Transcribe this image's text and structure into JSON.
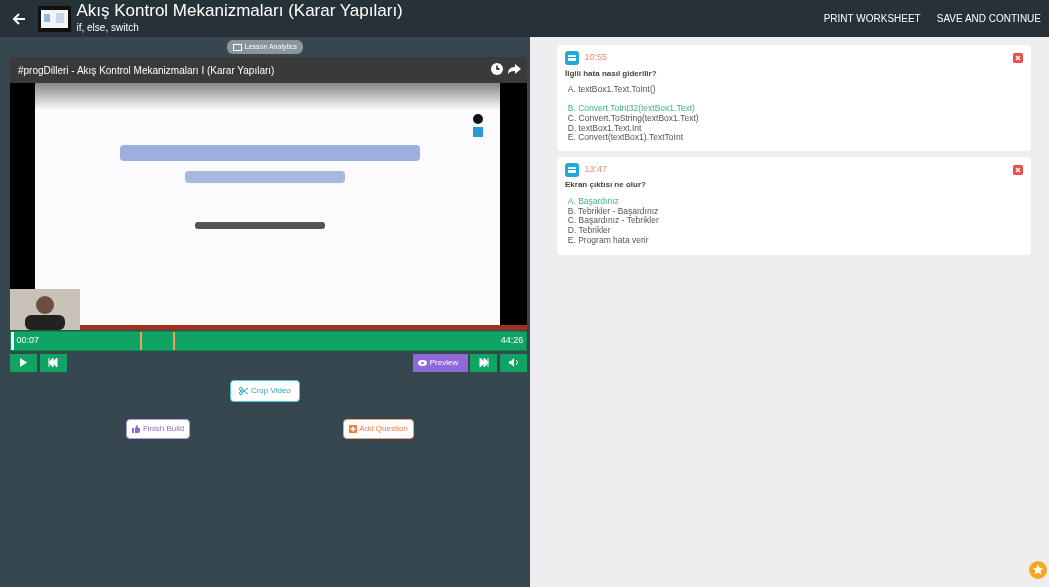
{
  "header": {
    "title": "Akış Kontrol Mekanizmaları (Karar Yapıları)",
    "subtitle": "if, else, switch"
  },
  "header_actions": [
    "PRINT WORKSHEET",
    "SAVE AND CONTINUE"
  ],
  "lesson_analytics": "Lesson Analytics",
  "video": {
    "kind": "picture",
    "title": "#progDilleri - Akış Kontrol Mekanizmaları I (Karar Yapıları)"
  },
  "timeline": {
    "current": "00:07",
    "total": "44:26",
    "level": 0.003,
    "markers": [
      {
        "level": 0.25
      },
      {
        "level": 0.315
      }
    ]
  },
  "player_controls": [
    {
      "kind": "play"
    },
    {
      "kind": "previous"
    },
    {
      "kind": "spacer"
    },
    {
      "kind": "preview",
      "label": "Preview"
    },
    {
      "kind": "next"
    },
    {
      "kind": "volume"
    }
  ],
  "crop_button": "Crop Video",
  "finish_button": "Finish Build",
  "add_question_button": "Add Question",
  "questions": [
    {
      "time": "10:55",
      "question": "İlgili hata nasıl giderilir?",
      "options": [
        {
          "text": "A. textBox1.Text.ToInt()",
          "correct": false
        },
        {
          "text": "B. Convert.ToInt32(textBox1.Text)",
          "correct": true
        },
        {
          "text": "C. Convert.ToString(textBox1.Text)",
          "correct": false
        },
        {
          "text": "D. textBox1.Text.Int",
          "correct": false
        },
        {
          "text": "E. Convert(textBox1).TextToInt",
          "correct": false
        }
      ]
    },
    {
      "time": "13:47",
      "question": "Ekran çıktısı ne olur?",
      "options": [
        {
          "text": "A. Başardınız",
          "correct": true
        },
        {
          "text": "B. Tebrikler - Başardınız",
          "correct": false
        },
        {
          "text": "C. Başardınız - Tebrikler",
          "correct": false
        },
        {
          "text": "D. Tebrikler",
          "correct": false
        },
        {
          "text": "E. Program hata verir",
          "correct": false
        }
      ]
    }
  ]
}
